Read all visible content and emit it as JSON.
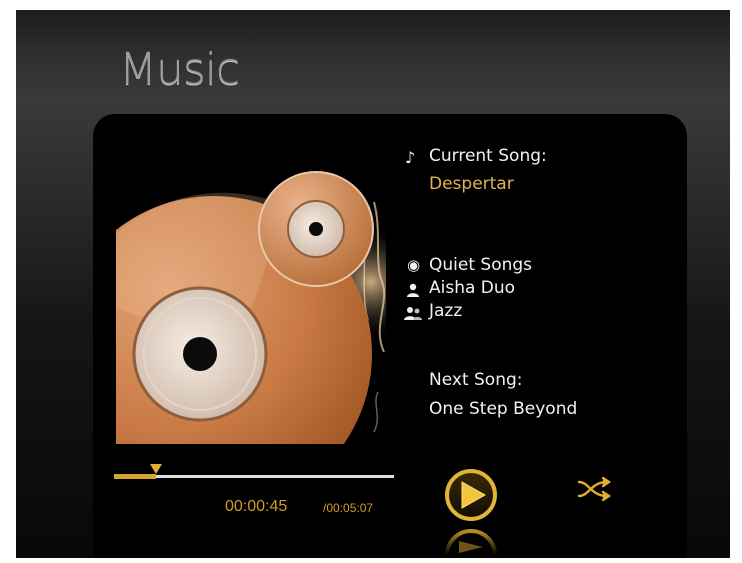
{
  "page": {
    "title": "Music"
  },
  "now_playing": {
    "current_label": "Current Song:",
    "current_title": "Despertar",
    "album": "Quiet Songs",
    "artist": "Aisha Duo",
    "genre": "Jazz",
    "next_label": "Next Song:",
    "next_title": "One Step Beyond"
  },
  "playback": {
    "elapsed": "00:00:45",
    "total": "/00:05:07",
    "progress": 0.15,
    "state": "paused"
  },
  "icons": {
    "current_song": "music-note-icon",
    "album": "disc-icon",
    "artist": "person-icon",
    "genre": "people-icon",
    "play": "play-icon",
    "shuffle": "shuffle-icon"
  },
  "colors": {
    "accent": "#d4a72c",
    "highlight_text": "#e1b54d",
    "text": "#f2f2f2",
    "panel": "#000000"
  }
}
